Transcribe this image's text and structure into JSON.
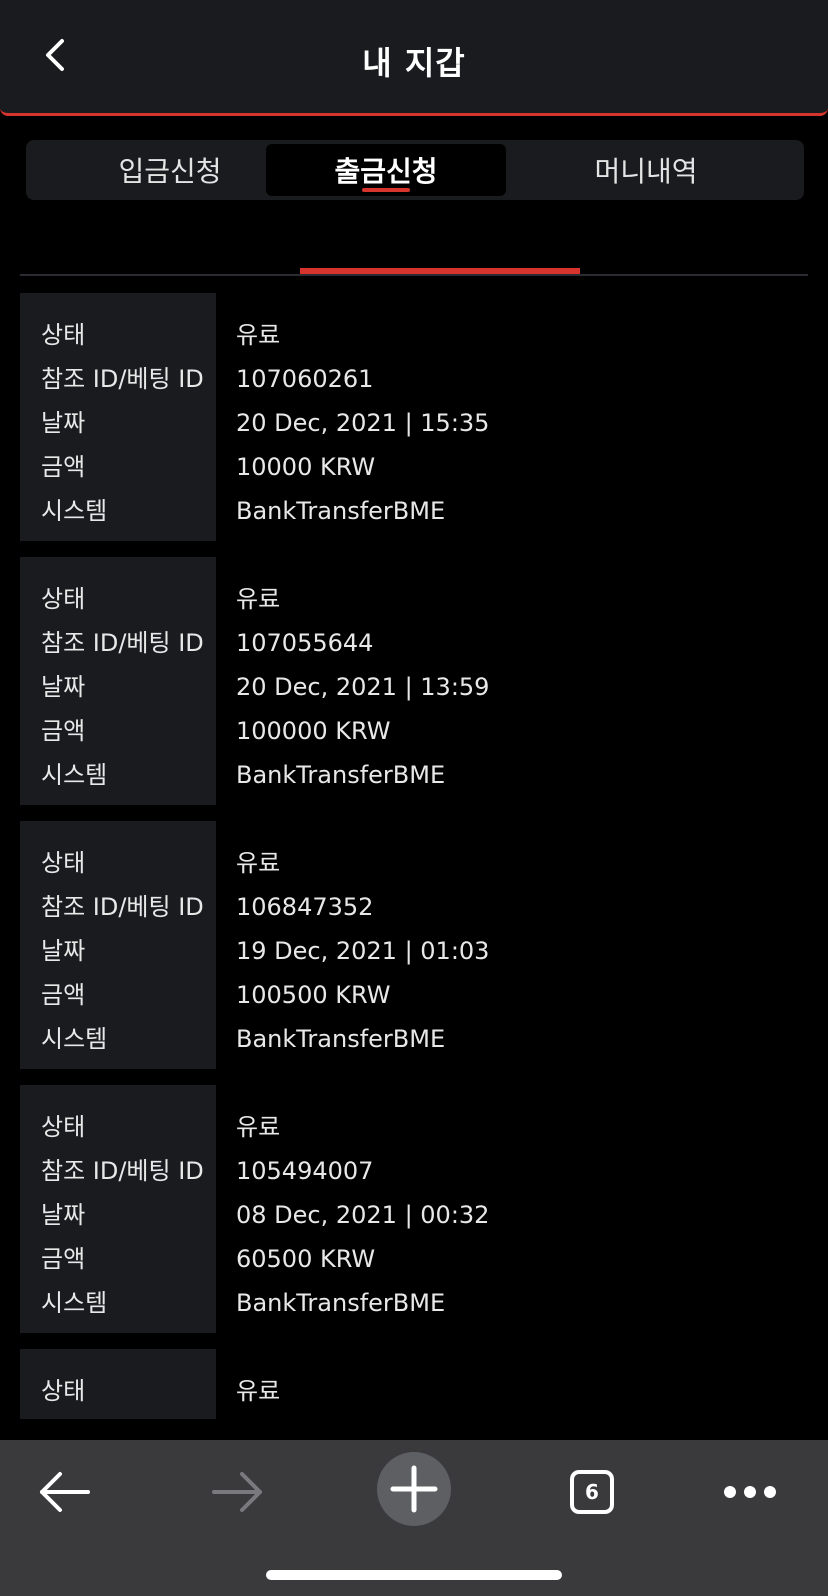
{
  "header": {
    "title": "내 지갑",
    "back_icon": "chevron-left-icon"
  },
  "tabs": [
    {
      "label": "입금신청",
      "active": false
    },
    {
      "label": "출금신청",
      "active": true
    },
    {
      "label": "머니내역",
      "active": false
    }
  ],
  "colors": {
    "accent": "#d7342d",
    "background": "#000000",
    "panel": "#1a1b1f",
    "bottom_bar": "#3a3a3d"
  },
  "field_labels": {
    "status": "상태",
    "ref_id": "참조 ID/베팅 ID",
    "date": "날짜",
    "amount": "금액",
    "system": "시스템"
  },
  "records": [
    {
      "status": "유료",
      "ref_id": "107060261",
      "date": "20 Dec, 2021 | 15:35",
      "amount": "10000 KRW",
      "system": "BankTransferBME"
    },
    {
      "status": "유료",
      "ref_id": "107055644",
      "date": "20 Dec, 2021 | 13:59",
      "amount": "100000 KRW",
      "system": "BankTransferBME"
    },
    {
      "status": "유료",
      "ref_id": "106847352",
      "date": "19 Dec, 2021 | 01:03",
      "amount": "100500 KRW",
      "system": "BankTransferBME"
    },
    {
      "status": "유료",
      "ref_id": "105494007",
      "date": "08 Dec, 2021 | 00:32",
      "amount": "60500 KRW",
      "system": "BankTransferBME"
    },
    {
      "status": "유료"
    }
  ],
  "browser_bar": {
    "back_icon": "arrow-left-icon",
    "forward_icon": "arrow-right-icon",
    "new_tab_icon": "plus-icon",
    "tab_count": "6",
    "more_icon": "more-dots-icon"
  }
}
